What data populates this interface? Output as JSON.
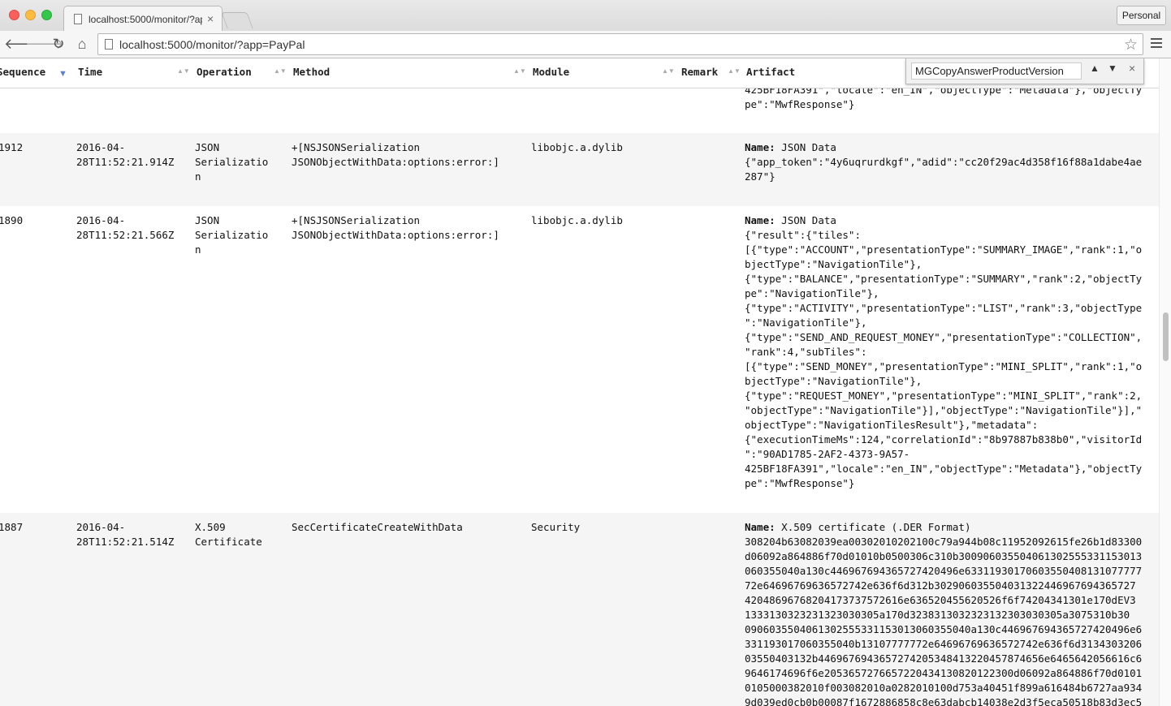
{
  "browser": {
    "tab_title": "localhost:5000/monitor/?ap",
    "tab_close": "×",
    "url": "localhost:5000/monitor/?app=PayPal",
    "profile": "Personal",
    "back_glyph": "🡐",
    "forward_glyph": "🡒",
    "reload_glyph": "↻",
    "home_glyph": "⌂",
    "star_glyph": "☆"
  },
  "find": {
    "query": "MGCopyAnswerProductVersion",
    "up": "▲",
    "down": "▼",
    "close": "×"
  },
  "table": {
    "headers": [
      "Sequence",
      "Time",
      "Operation",
      "Method",
      "Module",
      "Remark",
      "Artifact"
    ],
    "sort_active": "▼",
    "sort_both": "▲▼",
    "artifact_label": "Name:",
    "partial_row": {
      "artifact": "425BF18FA391\",\"locale\":\"en_IN\",\"objectType\":\"Metadata\"},\"objectTy\npe\":\"MwfResponse\"}"
    },
    "rows": [
      {
        "sequence": "1912",
        "time": "2016-04-\n28T11:52:21.914Z",
        "operation": "JSON\nSerializatio\nn",
        "method": "+[NSJSONSerialization\nJSONObjectWithData:options:error:]",
        "module": "libobjc.a.dylib",
        "remark": "",
        "artifact_name": "JSON Data",
        "artifact_body": "{\"app_token\":\"4y6uqrurdkgf\",\"adid\":\"cc20f29ac4d358f16f88a1dabe4ae\n287\"}"
      },
      {
        "sequence": "1890",
        "time": "2016-04-\n28T11:52:21.566Z",
        "operation": "JSON\nSerializatio\nn",
        "method": "+[NSJSONSerialization\nJSONObjectWithData:options:error:]",
        "module": "libobjc.a.dylib",
        "remark": "",
        "artifact_name": "JSON Data",
        "artifact_body": "{\"result\":{\"tiles\":\n[{\"type\":\"ACCOUNT\",\"presentationType\":\"SUMMARY_IMAGE\",\"rank\":1,\"o\nbjectType\":\"NavigationTile\"},\n{\"type\":\"BALANCE\",\"presentationType\":\"SUMMARY\",\"rank\":2,\"objectTy\npe\":\"NavigationTile\"},\n{\"type\":\"ACTIVITY\",\"presentationType\":\"LIST\",\"rank\":3,\"objectType\n\":\"NavigationTile\"},\n{\"type\":\"SEND_AND_REQUEST_MONEY\",\"presentationType\":\"COLLECTION\",\n\"rank\":4,\"subTiles\":\n[{\"type\":\"SEND_MONEY\",\"presentationType\":\"MINI_SPLIT\",\"rank\":1,\"o\nbjectType\":\"NavigationTile\"},\n{\"type\":\"REQUEST_MONEY\",\"presentationType\":\"MINI_SPLIT\",\"rank\":2,\n\"objectType\":\"NavigationTile\"}],\"objectType\":\"NavigationTile\"}],\"\nobjectType\":\"NavigationTilesResult\"},\"metadata\":\n{\"executionTimeMs\":124,\"correlationId\":\"8b97887b838b0\",\"visitorId\n\":\"90AD1785-2AF2-4373-9A57-\n425BF18FA391\",\"locale\":\"en_IN\",\"objectType\":\"Metadata\"},\"objectTy\npe\":\"MwfResponse\"}"
      },
      {
        "sequence": "1887",
        "time": "2016-04-\n28T11:52:21.514Z",
        "operation": "X.509\nCertificate",
        "method": "SecCertificateCreateWithData",
        "module": "Security",
        "remark": "",
        "artifact_name": "X.509 certificate (.DER Format)",
        "artifact_body": "308204b63082039ea00302010202100c79a944b08c11952092615fe26b1d83300\nd06092a864886f70d01010b0500306c310b30090603550406130255533115301З\n060355040a130c446967694365727420496e63311930170603550408131077777\n72e64696769636572742e636f6d312b302906035504031322446967694365727\n4204869676820417373757261​6e63652045562052​6f6f74204341301e170dEV3\n1333130323231323030305a170d3238313032323132303030305a3075310b30\n090603550406130255533115301306035504​0a130c4469676943657274​20496e6\n331193017060355040b13107777772e6469676963657274​2e636f6d3134303206\n03550403132b446967694365727420534841322045787465​6e6465642056616c6\n9646174696f6e205365727665722043413082012230​0d06092a864886f70d0101\n0105000382010f003082010a0282010100d753a40451f899a616484b6727aa934\n9d039ed0cb0b00087f1672886858c8e63dabcb14038e2d3f5eca50518b83d3ec5"
      }
    ]
  }
}
